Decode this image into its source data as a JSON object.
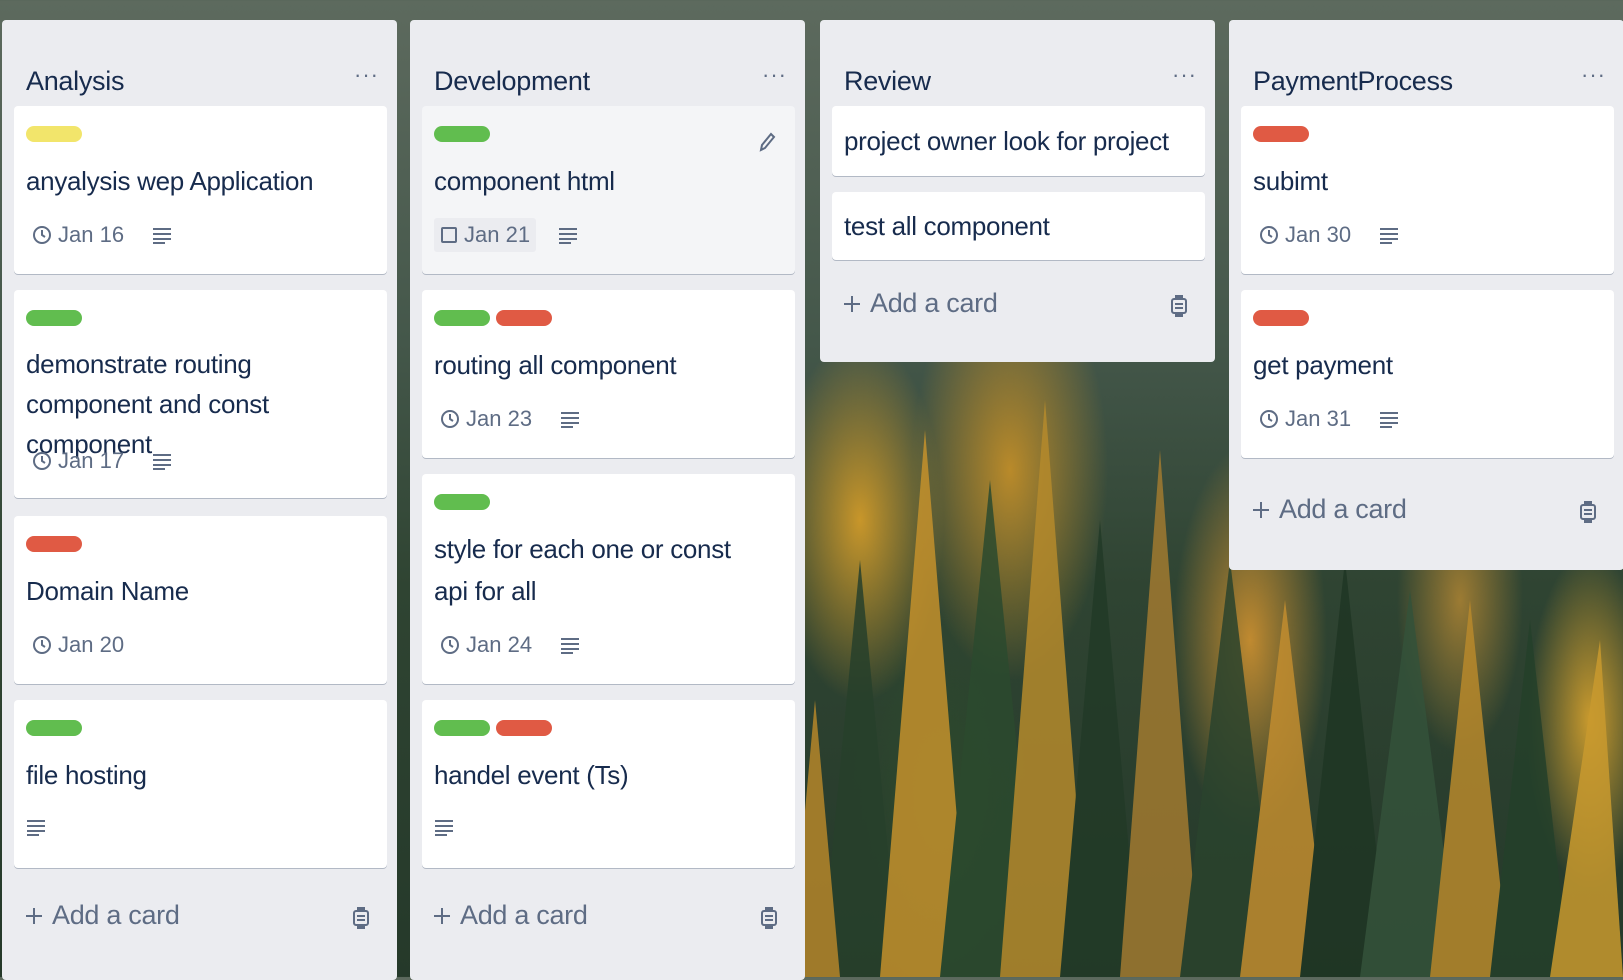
{
  "colors": {
    "list_bg": "#ebecf0",
    "card_bg": "#ffffff",
    "label_yellow": "#f2d600",
    "label_green": "#61bd4f",
    "label_red": "#eb5a46",
    "text_primary": "#172b4d",
    "text_muted": "#5e6c84"
  },
  "lists": [
    {
      "title": "Analysis",
      "menu": "···",
      "add_card": "Add a card",
      "cards": [
        {
          "labels": [
            "yellow"
          ],
          "title": "anyalysis wep Application",
          "date": "Jan 16",
          "has_description": true
        },
        {
          "labels": [
            "green"
          ],
          "title": "demonstrate routing component and const component",
          "date": "Jan 17",
          "has_description": true
        },
        {
          "labels": [
            "red"
          ],
          "title": "Domain Name",
          "date": "Jan 20",
          "has_description": false
        },
        {
          "labels": [
            "green"
          ],
          "title": "file hosting",
          "date": "",
          "has_description": true
        }
      ]
    },
    {
      "title": "Development",
      "menu": "···",
      "add_card": "Add a card",
      "cards": [
        {
          "labels": [
            "green"
          ],
          "title": "component html",
          "date": "Jan 21",
          "date_icon": "checkbox-icon",
          "has_description": true,
          "hovered": true
        },
        {
          "labels": [
            "green",
            "red"
          ],
          "title": "routing all component",
          "date": "Jan 23",
          "has_description": true
        },
        {
          "labels": [
            "green"
          ],
          "title": "style for each one or const api for all",
          "date": "Jan 24",
          "has_description": true
        },
        {
          "labels": [
            "green",
            "red"
          ],
          "title": "handel event (Ts)",
          "date": "",
          "has_description": true
        }
      ]
    },
    {
      "title": "Review",
      "menu": "···",
      "add_card": "Add a card",
      "cards": [
        {
          "labels": [],
          "title": "project owner look for project"
        },
        {
          "labels": [],
          "title": "test all component"
        }
      ]
    },
    {
      "title": "PaymentProcess",
      "menu": "···",
      "add_card": "Add a card",
      "cards": [
        {
          "labels": [
            "red"
          ],
          "title": "subimt",
          "date": "Jan 30",
          "has_description": true
        },
        {
          "labels": [
            "red"
          ],
          "title": "get payment",
          "date": "Jan 31",
          "has_description": true
        }
      ]
    }
  ]
}
